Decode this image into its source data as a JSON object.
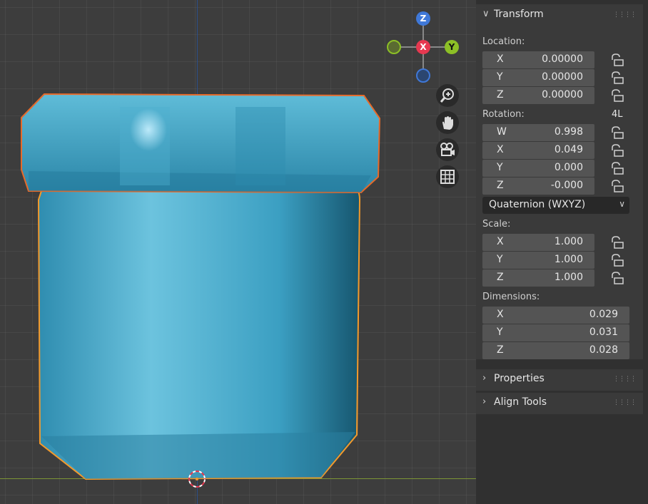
{
  "gizmo": {
    "z": "Z",
    "x": "X",
    "y": "Y"
  },
  "colors": {
    "axis_x": "#e63850",
    "axis_y": "#8cbf26",
    "axis_z": "#3f78d8",
    "object_fill": "#3fa3c4",
    "outline": "#f08a2a"
  },
  "transform": {
    "title": "Transform",
    "location": {
      "label": "Location:",
      "x": {
        "axis": "X",
        "value": "0.00000"
      },
      "y": {
        "axis": "Y",
        "value": "0.00000"
      },
      "z": {
        "axis": "Z",
        "value": "0.00000"
      }
    },
    "rotation": {
      "label": "Rotation:",
      "mode_short": "4L",
      "w": {
        "axis": "W",
        "value": "0.998"
      },
      "x": {
        "axis": "X",
        "value": "0.049"
      },
      "y": {
        "axis": "Y",
        "value": "0.000"
      },
      "z": {
        "axis": "Z",
        "value": "-0.000"
      },
      "mode": "Quaternion (WXYZ)"
    },
    "scale": {
      "label": "Scale:",
      "x": {
        "axis": "X",
        "value": "1.000"
      },
      "y": {
        "axis": "Y",
        "value": "1.000"
      },
      "z": {
        "axis": "Z",
        "value": "1.000"
      }
    },
    "dimensions": {
      "label": "Dimensions:",
      "x": {
        "axis": "X",
        "value": "0.029"
      },
      "y": {
        "axis": "Y",
        "value": "0.031"
      },
      "z": {
        "axis": "Z",
        "value": "0.028"
      }
    }
  },
  "panels": {
    "properties": "Properties",
    "align_tools": "Align Tools"
  }
}
